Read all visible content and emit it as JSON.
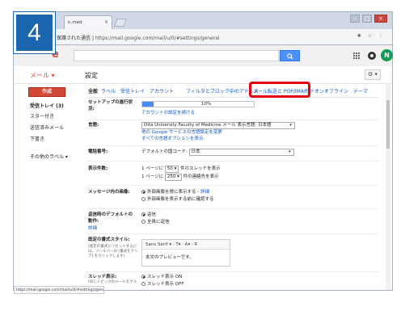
{
  "step_number": "4",
  "browser": {
    "tab_title": "n.med",
    "tab_close": "×",
    "address_prefix": "保護された通信",
    "address_url": "https://mail.google.com/mail/u/0/#settings/general",
    "address_icons": "✱ ☆ ⋮",
    "win_min": "–",
    "win_max": "□",
    "win_close": "×",
    "status_text": "https://mail.google.com/mail/u/0/#settings/general"
  },
  "gmail": {
    "logo_fragment": "e",
    "search_button_icon": "search-icon",
    "avatar_letter": "N",
    "mail_label": "メール ▾",
    "page_title": "設定",
    "gear_label": "⚙ ▾"
  },
  "sidebar": {
    "compose": "作成",
    "items": [
      "受信トレイ (3)",
      "スター付き",
      "送信済みメール",
      "下書き",
      "その他のラベル ▾"
    ]
  },
  "settings_tabs": [
    "全般",
    "ラベル",
    "受信トレイ",
    "アカウント",
    "フィルタとブロック中のアドレス",
    "メール転送と POP/IMAP",
    "アドオン",
    "オフライン",
    "テーマ"
  ],
  "settings": {
    "setup_label": "セットアップの進行状況:",
    "setup_percent": "10%",
    "setup_fraction": 0.1,
    "setup_link": "アカウントの設定を続ける",
    "language_label": "言語:",
    "language_value": "Oita University Faculty of Medicine メール 表示言語: 日本語",
    "language_link1": "他の Google サービスの言語設定を変更",
    "language_link2": "すべての言語オプションを表示",
    "phone_label": "電話番号:",
    "phone_prefix": "デフォルトの国コード:",
    "phone_country": "日本",
    "display_label": "表示件数:",
    "display_row1_pre": "1 ページに",
    "display_row1_val": "50",
    "display_row1_post": "件のスレッドを表示",
    "display_row2_pre": "1 ページに",
    "display_row2_val": "250",
    "display_row2_post": "件の連絡先を表示",
    "images_label": "メッセージ内の画像:",
    "images_opt1": "外部画像を常に表示する -",
    "images_opt1_link": "詳細",
    "images_opt2": "外部画像を表示する前に確認する",
    "reply_label": "返信時のデフォルトの動作:",
    "reply_link": "詳細",
    "reply_opt1": "返信",
    "reply_opt2": "全員に返信",
    "style_label": "既定の書式スタイル:",
    "style_sub": "(既定の書式にリセットするには、ツールバーの [書式をクリア] をクリックします)",
    "style_toolbar": "Sans Serif  ▾  ·  T▾  ·  A▾  ·  T̶",
    "style_preview": "本文のプレビューです。",
    "thread_label": "スレッド表示:",
    "thread_sub": "(同じトピックのメールをグル",
    "thread_opt1": "スレッド表示 ON",
    "thread_opt2": "スレッド表示 OFF"
  },
  "colors": {
    "step_badge": "#1c66b0",
    "highlight": "#e3000f",
    "compose": "#d14836",
    "link": "#1155cc"
  }
}
